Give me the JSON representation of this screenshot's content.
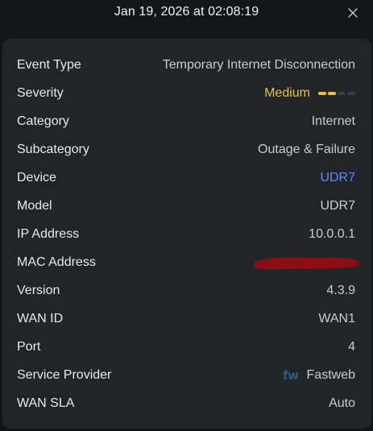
{
  "header": {
    "timestamp": "Jan 19, 2026 at 02:08:19",
    "close_icon": "close-icon"
  },
  "details": {
    "event_type": {
      "label": "Event Type",
      "value": "Temporary Internet Disconnection"
    },
    "severity": {
      "label": "Severity",
      "value": "Medium",
      "level": 2,
      "max_level": 4,
      "color": "#e8c33c"
    },
    "category": {
      "label": "Category",
      "value": "Internet"
    },
    "subcategory": {
      "label": "Subcategory",
      "value": "Outage & Failure"
    },
    "device": {
      "label": "Device",
      "value": "UDR7",
      "color": "#5b8ef7"
    },
    "model": {
      "label": "Model",
      "value": "UDR7"
    },
    "ip_address": {
      "label": "IP Address",
      "value": "10.0.0.1"
    },
    "mac_address": {
      "label": "MAC Address",
      "redaction_color": "#8b0d16"
    },
    "version": {
      "label": "Version",
      "value": "4.3.9"
    },
    "wan_id": {
      "label": "WAN ID",
      "value": "WAN1"
    },
    "port": {
      "label": "Port",
      "value": "4"
    },
    "service_provider": {
      "label": "Service Provider",
      "logo_text": "fw",
      "value": "Fastweb"
    },
    "wan_sla": {
      "label": "WAN SLA",
      "value": "Auto"
    }
  }
}
